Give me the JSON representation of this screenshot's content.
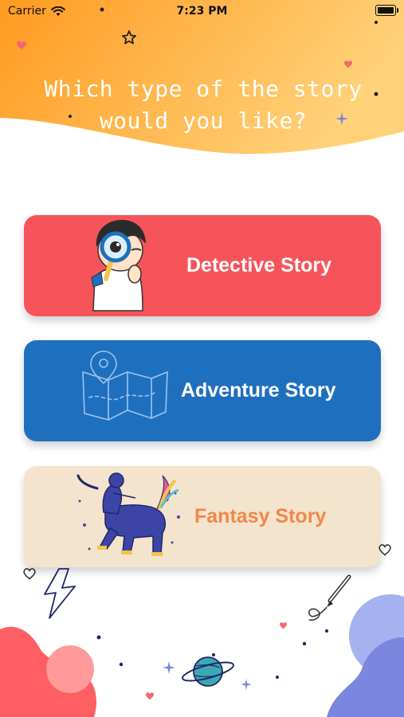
{
  "status_bar": {
    "carrier": "Carrier",
    "time": "7:23 PM"
  },
  "header": {
    "question_line1": "Which type of the story",
    "question_line2": "would you like?"
  },
  "stories": [
    {
      "label": "Detective Story",
      "color": "#f6545a",
      "text_color": "#ffffff",
      "icon": "boy-with-magnifier"
    },
    {
      "label": "Adventure Story",
      "color": "#1f6fbf",
      "text_color": "#ffffff",
      "icon": "map-pin"
    },
    {
      "label": "Fantasy Story",
      "color": "#f4e4cd",
      "text_color": "#f0884a",
      "icon": "centaur"
    }
  ],
  "colors": {
    "header_gradient_start": "#ff9a1f",
    "header_gradient_end": "#ffd27a",
    "blob_pink": "#ff5f63",
    "blob_purple": "#7b86de"
  }
}
